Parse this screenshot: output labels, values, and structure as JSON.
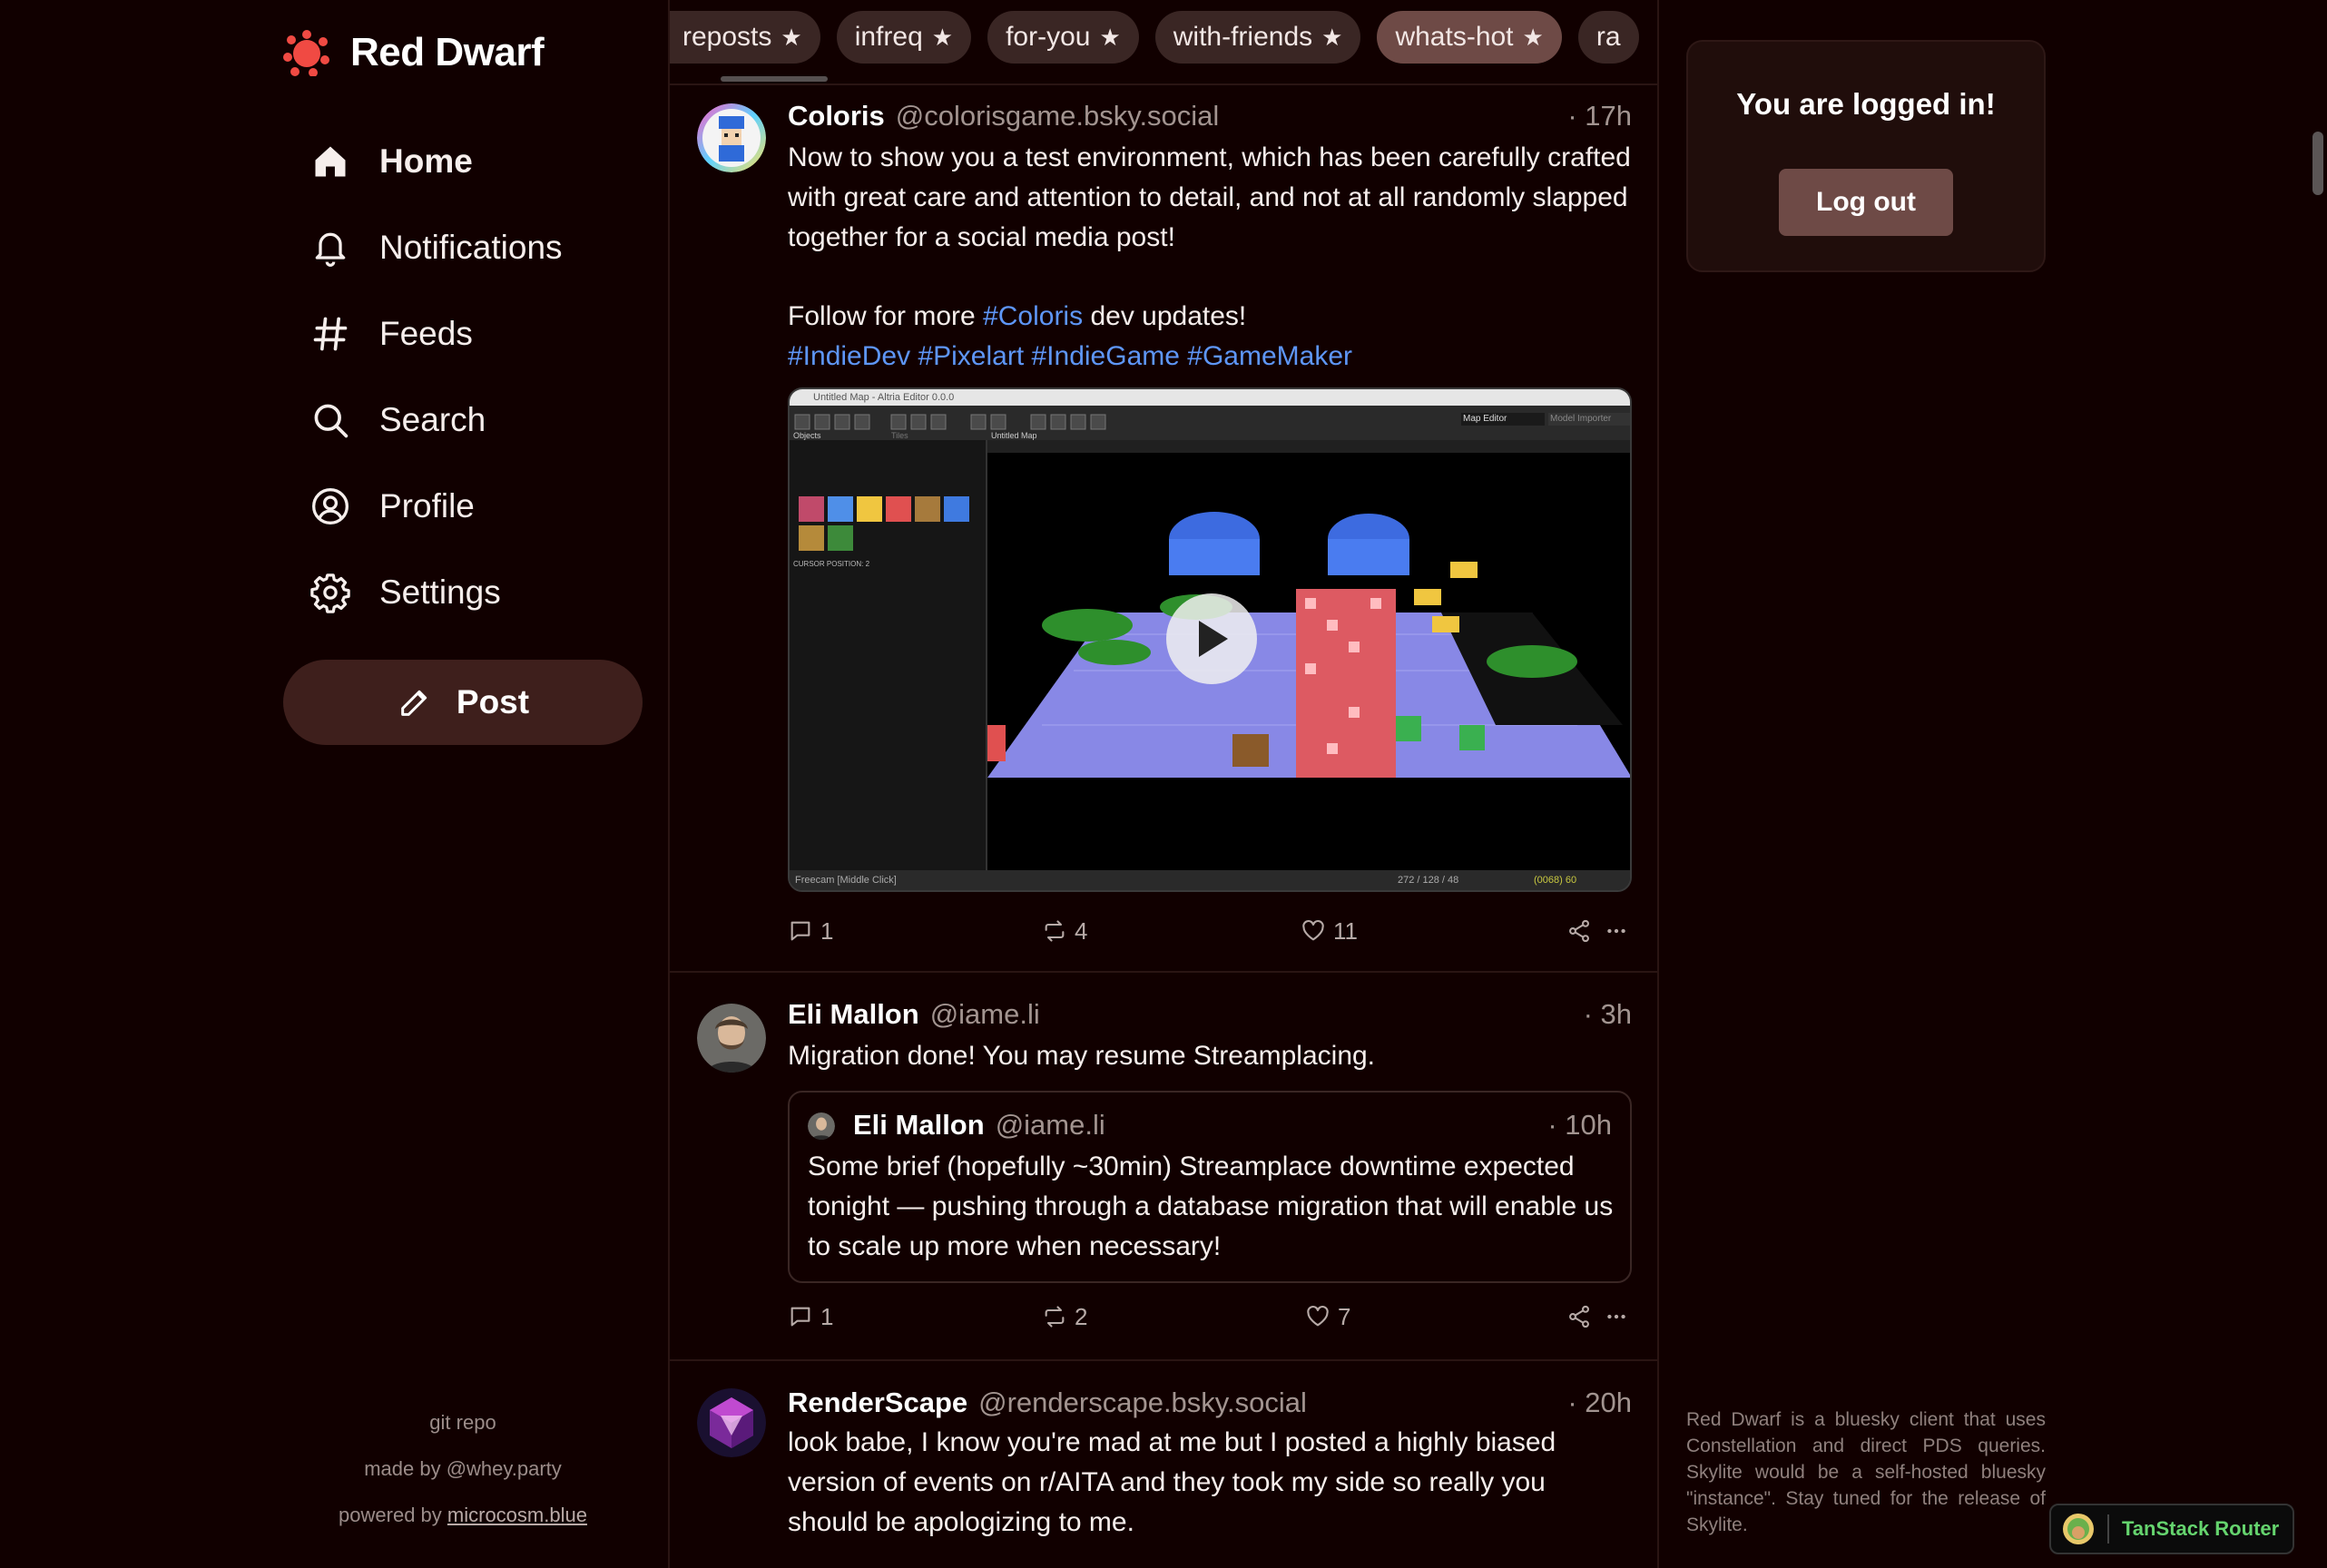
{
  "app": {
    "name": "Red Dwarf",
    "accent": "#f04a43",
    "background": "#110000"
  },
  "nav": {
    "items": [
      {
        "label": "Home",
        "icon": "home-icon",
        "active": true
      },
      {
        "label": "Notifications",
        "icon": "bell-icon"
      },
      {
        "label": "Feeds",
        "icon": "hash-icon"
      },
      {
        "label": "Search",
        "icon": "search-icon"
      },
      {
        "label": "Profile",
        "icon": "user-circle-icon"
      },
      {
        "label": "Settings",
        "icon": "gear-icon"
      }
    ],
    "post_label": "Post"
  },
  "sidebar_footer": {
    "git": "git repo",
    "made_by": "made by @whey.party",
    "powered_prefix": "powered by ",
    "powered_link": "microcosm.blue"
  },
  "feed_tabs": [
    {
      "label": "reposts",
      "star": "★"
    },
    {
      "label": "infreq",
      "star": "★"
    },
    {
      "label": "for-you",
      "star": "★"
    },
    {
      "label": "with-friends",
      "star": "★"
    },
    {
      "label": "whats-hot",
      "star": "★",
      "active": true
    },
    {
      "label": "ra",
      "star": ""
    }
  ],
  "posts": [
    {
      "author": "Coloris",
      "handle": "@colorisgame.bsky.social",
      "time": "· 17h",
      "text": "Now to show you a test environment, which has been carefully crafted with great care and attention to detail, and not at all randomly slapped together for a social media post!",
      "follow_prefix": "Follow for more ",
      "follow_tag": "#Coloris",
      "follow_suffix": " dev updates!",
      "tags": [
        "#IndieDev",
        "#Pixelart",
        "#IndieGame",
        "#GameMaker"
      ],
      "media": {
        "window_title": "Untitled Map - Altria Editor 0.0.0",
        "panel_tab_1": "Objects",
        "panel_tab_2": "Tiles",
        "viewport_tab": "Untitled Map",
        "mode_1": "Map Editor",
        "mode_2": "Model Importer",
        "cursor_position": "CURSOR POSITION: 2",
        "status_left": "Freecam [Middle Click]",
        "status_coords": "272 / 128 / 48",
        "status_fps": "(0068) 60"
      },
      "replies": "1",
      "reposts": "4",
      "likes": "11"
    },
    {
      "author": "Eli Mallon",
      "handle": "@iame.li",
      "time": "· 3h",
      "text": "Migration done! You may resume Streamplacing.",
      "quote": {
        "author": "Eli Mallon",
        "handle": "@iame.li",
        "time": "· 10h",
        "text": "Some brief (hopefully ~30min) Streamplace downtime expected tonight — pushing through a database migration that will enable us to scale up more when necessary!"
      },
      "replies": "1",
      "reposts": "2",
      "likes": "7"
    },
    {
      "author": "RenderScape",
      "handle": "@renderscape.bsky.social",
      "time": "· 20h",
      "text": "look babe, I know you're mad at me but I posted a highly biased version of events on r/AITA and they took my side so really you should be apologizing to me."
    }
  ],
  "login": {
    "title": "You are logged in!",
    "logout_label": "Log out"
  },
  "about": "Red Dwarf is a bluesky client that uses Constellation and direct PDS queries. Skylite would be a self-hosted bluesky \"instance\". Stay tuned for the release of Skylite.",
  "devtools": {
    "label": "TanStack Router"
  }
}
